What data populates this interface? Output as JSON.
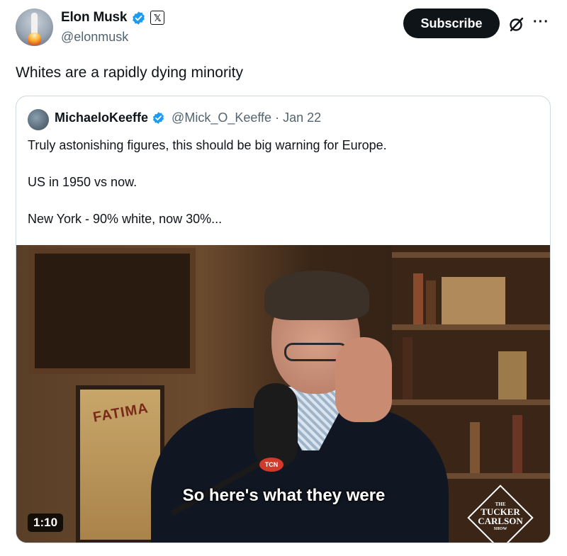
{
  "author": {
    "display_name": "Elon Musk",
    "handle": "@elonmusk",
    "x_badge": "𝕏",
    "verified_color": "#1d9bf0"
  },
  "actions": {
    "subscribe_label": "Subscribe",
    "more_label": "···"
  },
  "tweet": {
    "text": "Whites are a rapidly dying minority"
  },
  "quoted_tweet": {
    "display_name": "MichaeloKeeffe",
    "handle": "@Mick_O_Keeffe",
    "separator": "·",
    "date": "Jan 22",
    "lines": [
      "Truly astonishing figures, this should be big warning for Europe.",
      "US in 1950 vs now.",
      "New York - 90% white, now 30%..."
    ],
    "media": {
      "caption": "So here's what they were",
      "duration": "1:10",
      "poster_text": "FATIMA",
      "mic_badge": "TCN",
      "logo": {
        "the": "THE",
        "line1": "TUCKER",
        "line2": "CARLSON",
        "show": "SHOW"
      }
    }
  }
}
